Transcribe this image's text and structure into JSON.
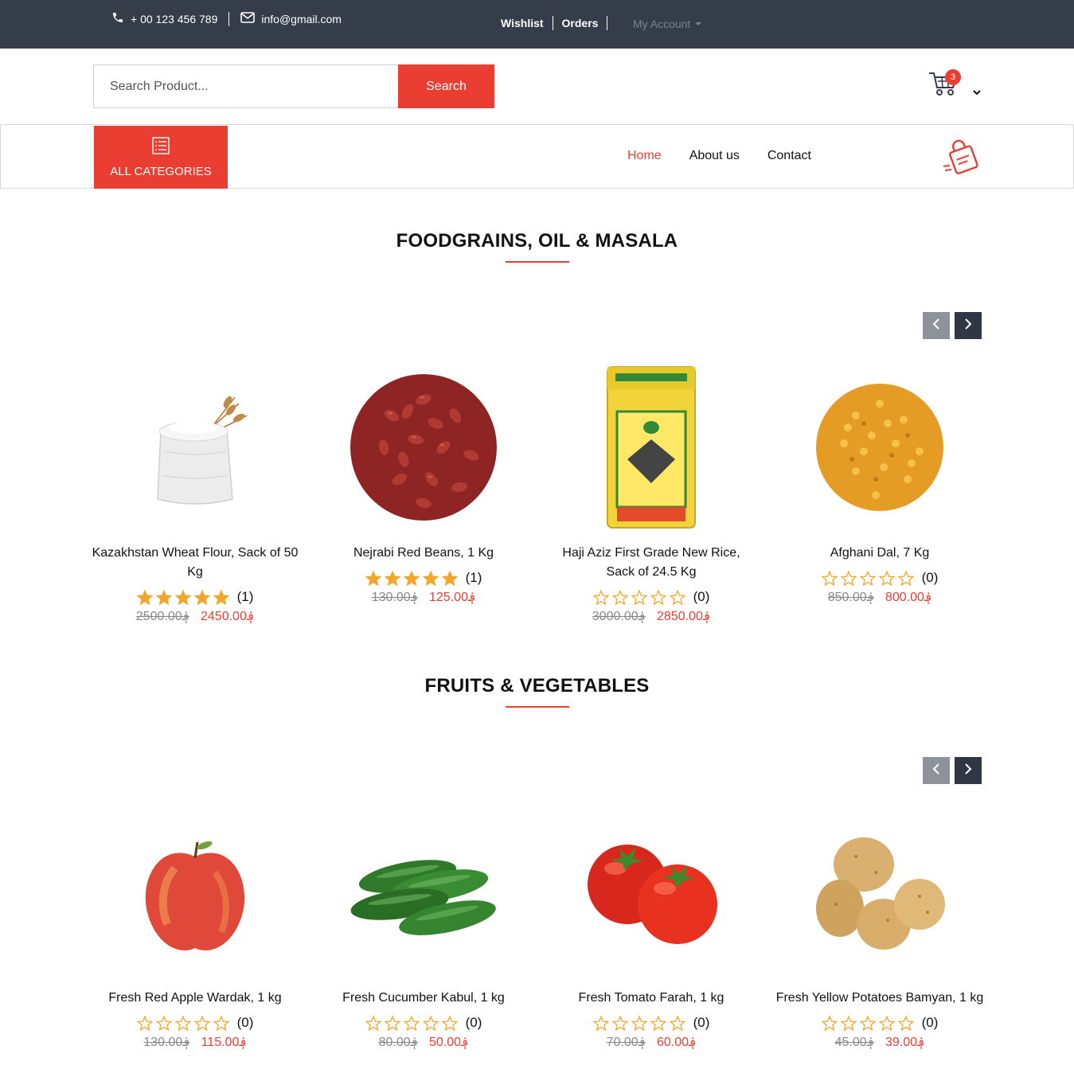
{
  "topbar": {
    "phone": "+ 00 123 456 789",
    "email": "info@gmail.com",
    "links": [
      "Wishlist",
      "Orders"
    ],
    "account": "My Account"
  },
  "search": {
    "placeholder": "Search Product...",
    "button": "Search"
  },
  "cart": {
    "count": "3"
  },
  "nav": {
    "categories": "ALL CATEGORIES",
    "menu": [
      "Home",
      "About us",
      "Contact"
    ],
    "active": "Home"
  },
  "colors": {
    "accent": "#eb3e32",
    "topbar": "#353d4a",
    "star": "#f4a62a"
  },
  "sections": [
    {
      "title": "FOODGRAINS, OIL & MASALA",
      "products": [
        {
          "name": "Kazakhstan Wheat Flour, Sack of 50 Kg",
          "rating": 5,
          "reviews": "(1)",
          "old_price": "2500.00",
          "price": "2450.00",
          "icon": "flour-sack-icon"
        },
        {
          "name": "Nejrabi Red Beans, 1 Kg",
          "rating": 5,
          "reviews": "(1)",
          "old_price": "130.00",
          "price": "125.00",
          "icon": "red-beans-icon"
        },
        {
          "name": "Haji Aziz First Grade New Rice, Sack of 24.5 Kg",
          "rating": 0,
          "reviews": "(0)",
          "old_price": "3000.00",
          "price": "2850.00",
          "icon": "rice-sack-icon"
        },
        {
          "name": "Afghani Dal, 7 Kg",
          "rating": 0,
          "reviews": "(0)",
          "old_price": "850.00",
          "price": "800.00",
          "icon": "dal-icon"
        }
      ]
    },
    {
      "title": "FRUITS & VEGETABLES",
      "products": [
        {
          "name": "Fresh Red Apple Wardak, 1 kg",
          "rating": 0,
          "reviews": "(0)",
          "old_price": "130.00",
          "price": "115.00",
          "icon": "apple-icon"
        },
        {
          "name": "Fresh Cucumber Kabul, 1 kg",
          "rating": 0,
          "reviews": "(0)",
          "old_price": "80.00",
          "price": "50.00",
          "icon": "cucumber-icon"
        },
        {
          "name": "Fresh Tomato Farah, 1 kg",
          "rating": 0,
          "reviews": "(0)",
          "old_price": "70.00",
          "price": "60.00",
          "icon": "tomato-icon"
        },
        {
          "name": "Fresh Yellow Potatoes Bamyan, 1 kg",
          "rating": 0,
          "reviews": "(0)",
          "old_price": "45.00",
          "price": "39.00",
          "icon": "potato-icon"
        }
      ]
    }
  ],
  "currency_symbol": "؋"
}
